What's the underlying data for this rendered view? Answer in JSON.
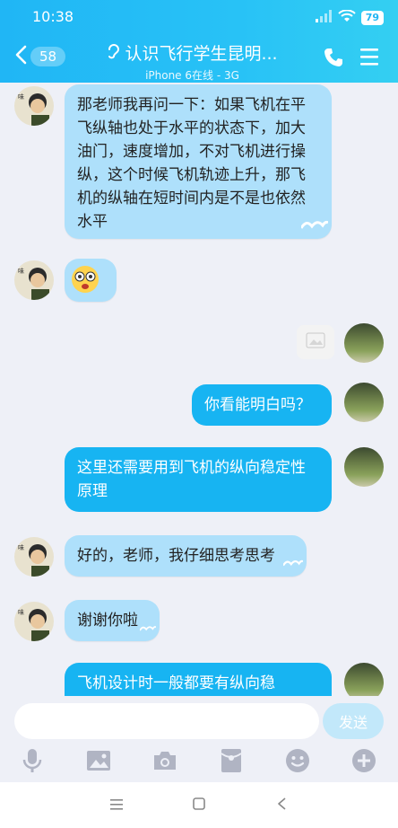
{
  "status_bar": {
    "time": "10:38",
    "battery": "79"
  },
  "header": {
    "unread_count": "58",
    "title": "认识飞行学生昆明...",
    "subtitle": "iPhone 6在线 - 3G"
  },
  "messages": [
    {
      "side": "left",
      "text": "那老师我再问一下：如果飞机在平飞纵轴也处于水平的状态下，加大油门，速度增加，不对飞机进行操纵，这个时候飞机轨迹上升，那飞机的纵轴在短时间内是不是也依然水平"
    },
    {
      "side": "left",
      "emoji": "surprised-face"
    },
    {
      "side": "right",
      "image": "image-placeholder"
    },
    {
      "side": "right",
      "text": "你看能明白吗？"
    },
    {
      "side": "left",
      "text": "这里还需要用到飞机的纵向稳定性原理"
    },
    {
      "side": "left",
      "text": "好的，老师，我仔细思考思考"
    },
    {
      "side": "left",
      "text": "谢谢你啦"
    },
    {
      "side": "left",
      "text": "飞机设计时一般都要有纵向稳"
    }
  ],
  "input": {
    "placeholder": "",
    "send_label": "发送"
  },
  "toolbar": [
    "mic-icon",
    "image-icon",
    "camera-icon",
    "red-packet-icon",
    "emoji-icon",
    "plus-icon"
  ],
  "colors": {
    "header": "#22b8f5",
    "bubble_left": "#aee0fb",
    "bubble_right": "#17b4f2",
    "send_disabled": "#c2e8fa"
  }
}
